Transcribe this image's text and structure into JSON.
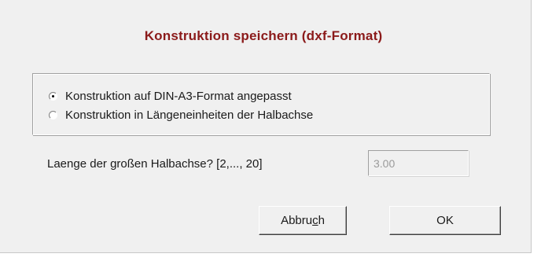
{
  "dialog": {
    "title": "Konstruktion speichern (dxf-Format)"
  },
  "options": {
    "items": [
      {
        "label": "Konstruktion auf DIN-A3-Format angepasst",
        "selected": true
      },
      {
        "label": "Konstruktion in Längeneinheiten der Halbachse",
        "selected": false
      }
    ]
  },
  "halbachse": {
    "label": "Laenge der großen Halbachse? [2,..., 20]",
    "value": "3.00",
    "enabled": false
  },
  "buttons": {
    "cancel_prefix": "Abbru",
    "cancel_mnemonic": "c",
    "cancel_suffix": "h",
    "ok_label": "OK"
  }
}
